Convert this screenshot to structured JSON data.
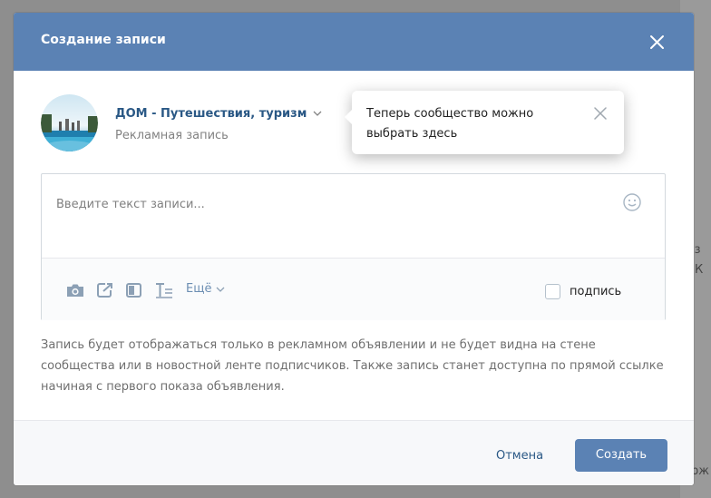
{
  "modal": {
    "title": "Создание записи"
  },
  "author": {
    "community_name": "ДОМ - Путешествия, туризм",
    "post_type": "Рекламная запись"
  },
  "tooltip": {
    "text": "Теперь сообщество можно выбрать здесь"
  },
  "composer": {
    "placeholder": "Введите текст записи...",
    "more_label": "Ещё",
    "signature_label": "подпись",
    "signature_checked": false
  },
  "info": {
    "text": "Запись будет отображаться только в рекламном объявлении и не будет видна на стене сообщества или в новостной ленте подписчиков. Также запись станет доступна по прямой ссылке начиная с первого показа объявления."
  },
  "footer": {
    "cancel_label": "Отмена",
    "create_label": "Создать"
  },
  "background": {
    "fragment_1": "із",
    "fragment_2": "К",
    "fragment_3": "рж"
  },
  "colors": {
    "header": "#5b82b4",
    "link": "#2a5885",
    "primary_button": "#5b82b4"
  },
  "icons": [
    "close-icon",
    "chevron-down-icon",
    "smile-icon",
    "camera-icon",
    "share-icon",
    "article-icon",
    "text-format-icon"
  ]
}
